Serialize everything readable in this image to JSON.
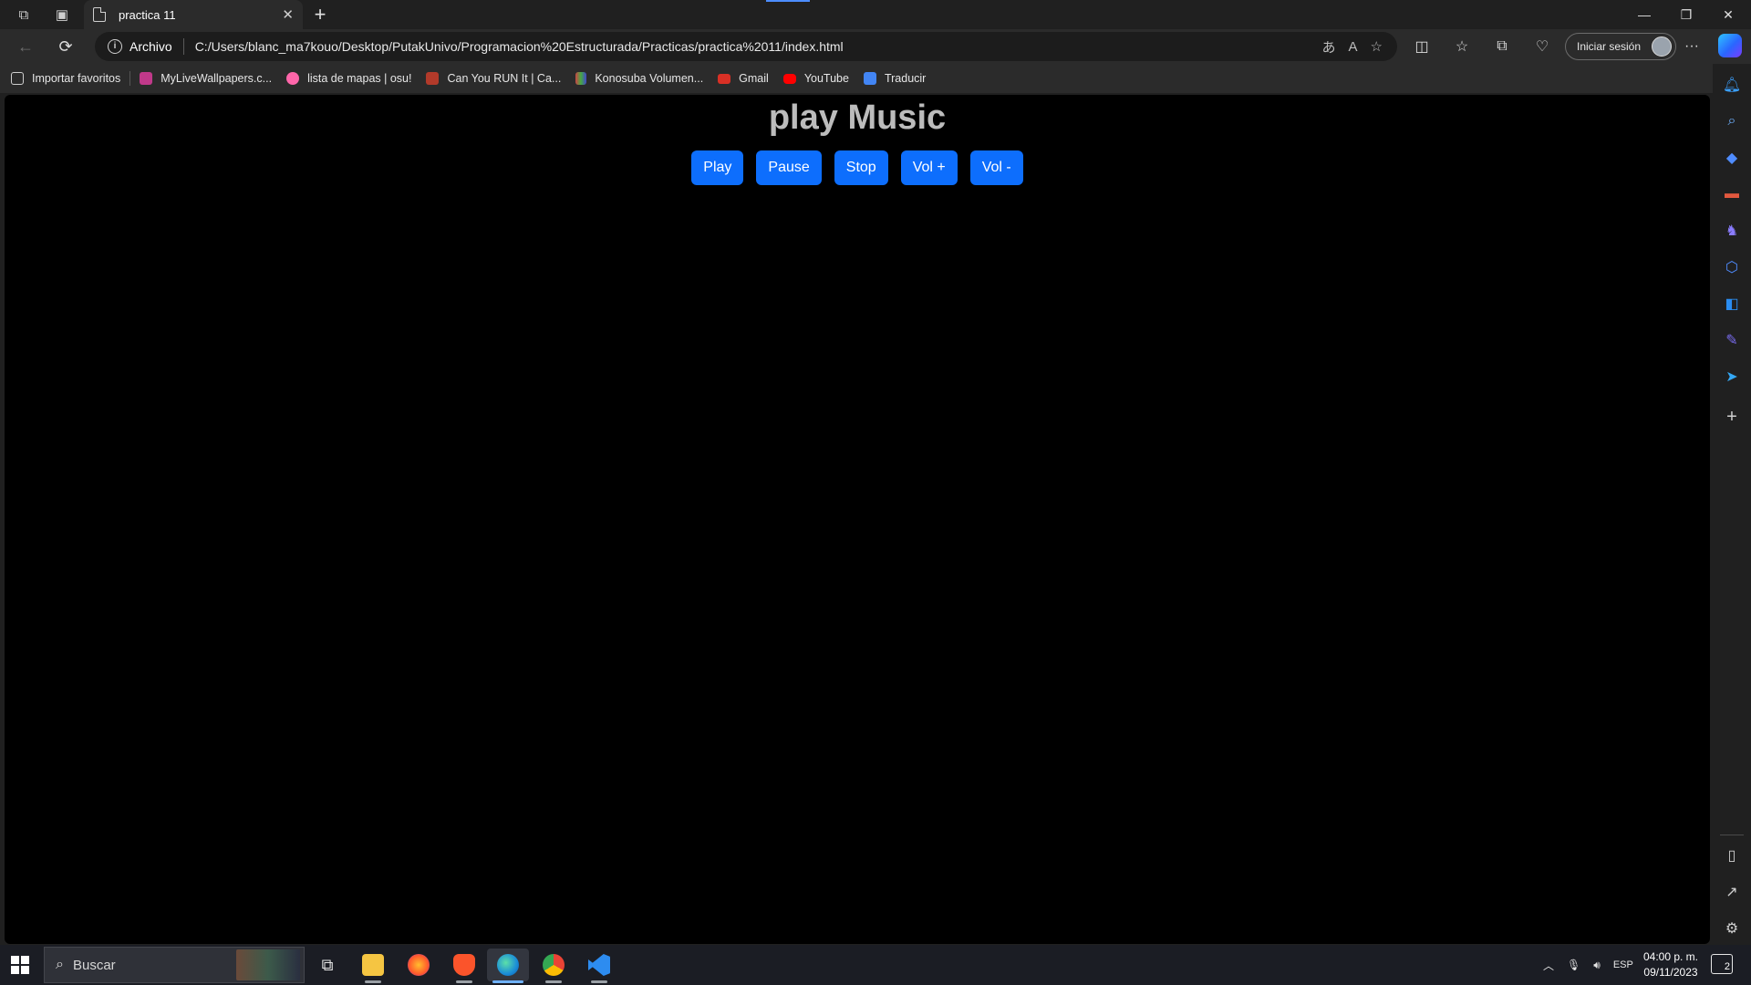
{
  "tab": {
    "title": "practica 11",
    "close_glyph": "✕"
  },
  "window_controls": {
    "minimize": "—",
    "restore": "❐",
    "close": "✕"
  },
  "address": {
    "origin_label": "Archivo",
    "url": "C:/Users/blanc_ma7kouo/Desktop/PutakUnivo/Programacion%20Estructurada/Practicas/practica%2011/index.html"
  },
  "toolbar": {
    "signin_label": "Iniciar sesión",
    "more_glyph": "···"
  },
  "favorites": [
    {
      "label": "Importar favoritos",
      "icon": "import-icon",
      "color": "#cfcfcf"
    },
    {
      "label": "MyLiveWallpapers.c...",
      "icon": "mylivewallpapers-icon",
      "color": "#c0398a"
    },
    {
      "label": "lista de mapas | osu!",
      "icon": "osu-icon",
      "color": "#ff66aa"
    },
    {
      "label": "Can You RUN It | Ca...",
      "icon": "canyourunit-icon",
      "color": "#b23a2a"
    },
    {
      "label": "Konosuba Volumen...",
      "icon": "konosuba-icon",
      "color": "#7c5cc4"
    },
    {
      "label": "Gmail",
      "icon": "gmail-icon",
      "color": "#d93025"
    },
    {
      "label": "YouTube",
      "icon": "youtube-icon",
      "color": "#ff0000"
    },
    {
      "label": "Traducir",
      "icon": "translate-icon",
      "color": "#4285f4"
    }
  ],
  "page": {
    "title": "play Music",
    "buttons": [
      {
        "label": "Play"
      },
      {
        "label": "Pause"
      },
      {
        "label": "Stop"
      },
      {
        "label": "Vol +"
      },
      {
        "label": "Vol -"
      }
    ],
    "button_color": "#0d6efd"
  },
  "taskbar": {
    "search_placeholder": "Buscar",
    "language": "ESP",
    "time": "04:00 p. m.",
    "date": "09/11/2023",
    "notification_count": "2"
  }
}
